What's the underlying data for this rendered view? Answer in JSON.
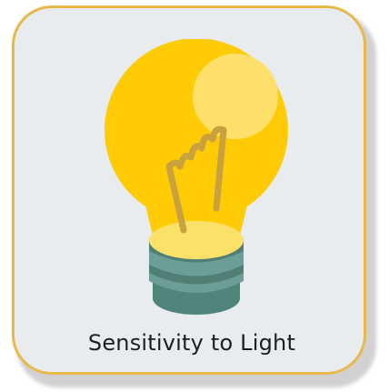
{
  "card": {
    "label": "Sensitivity to Light",
    "icon": "light-bulb-icon",
    "colors": {
      "border": "#e8b84a",
      "background": "#e8ecef",
      "bulb_glass": "#ffcc00",
      "bulb_highlight": "#ffe066",
      "filament": "#c8a13a",
      "base_dark": "#4e8a7f",
      "base_light": "#6a9e95"
    }
  }
}
